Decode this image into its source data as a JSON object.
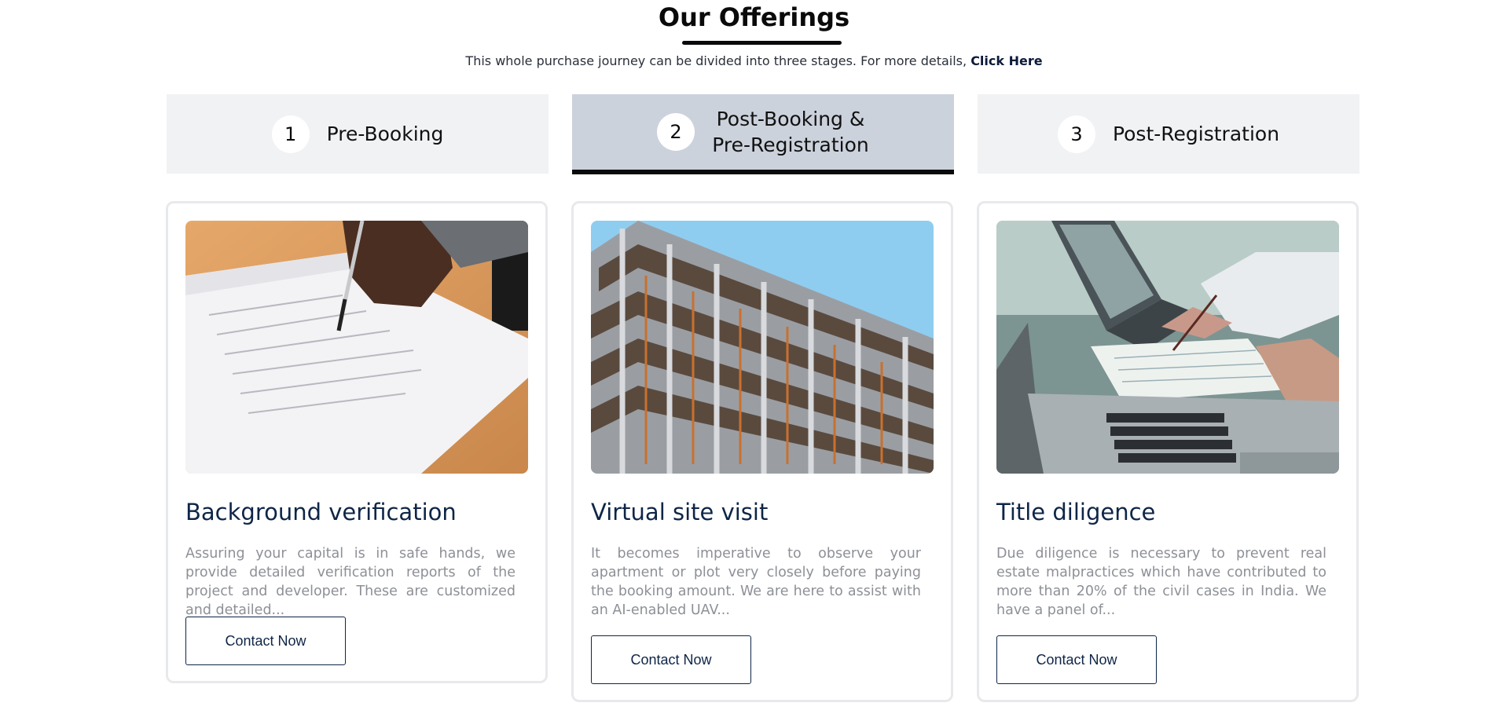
{
  "header": {
    "title": "Our Offerings",
    "subtitle": "This whole purchase journey can be divided into three stages. For more details,",
    "subtitle_link": "Click Here"
  },
  "tabs": [
    {
      "number": "1",
      "label": "Pre-Booking",
      "active": false
    },
    {
      "number": "2",
      "label": "Post-Booking & Pre-Registration",
      "active": true
    },
    {
      "number": "3",
      "label": "Post-Registration",
      "active": false
    }
  ],
  "cards": [
    {
      "image": "contract-signing-photo",
      "title": "Background verification",
      "description": "Assuring your capital is in safe hands, we provide detailed verification reports of the project and developer. These are customized and detailed...",
      "button": "Contact Now"
    },
    {
      "image": "building-construction-photo",
      "title": "Virtual site visit",
      "description": "It becomes imperative to observe your apartment or plot very closely before paying the booking amount. We are here to assist with an AI-enabled UAV...",
      "button": "Contact Now"
    },
    {
      "image": "laptop-documents-photo",
      "title": "Title diligence",
      "description": "Due diligence is necessary to prevent real estate malpractices which have contributed to more than 20% of the civil cases in India. We have a panel of...",
      "button": "Contact Now"
    }
  ],
  "colors": {
    "accent": "#0e2547",
    "tab_bg": "#f1f2f4",
    "tab_active_bg": "#ccd2dc",
    "muted_text": "#8d9096"
  }
}
